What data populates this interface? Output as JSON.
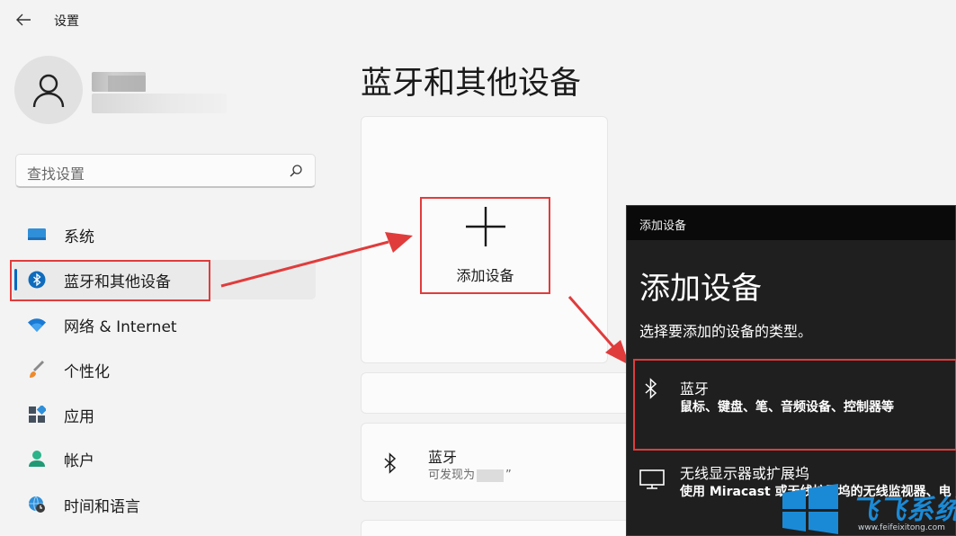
{
  "app": {
    "title": "设置"
  },
  "search": {
    "placeholder": "查找设置"
  },
  "sidebar": {
    "items": [
      {
        "label": "系统",
        "icon": "system-icon"
      },
      {
        "label": "蓝牙和其他设备",
        "icon": "bluetooth-icon",
        "active": true
      },
      {
        "label": "网络 & Internet",
        "icon": "wifi-icon"
      },
      {
        "label": "个性化",
        "icon": "brush-icon"
      },
      {
        "label": "应用",
        "icon": "apps-icon"
      },
      {
        "label": "帐户",
        "icon": "account-icon"
      },
      {
        "label": "时间和语言",
        "icon": "globe-clock-icon"
      }
    ]
  },
  "main": {
    "title": "蓝牙和其他设备",
    "add_device_label": "添加设备",
    "bluetooth_card": {
      "title": "蓝牙",
      "sub_prefix": "可发现为",
      "sub_suffix": "”"
    }
  },
  "dialog": {
    "caption": "添加设备",
    "heading": "添加设备",
    "subtitle": "选择要添加的设备的类型。",
    "options": [
      {
        "title": "蓝牙",
        "desc": "鼠标、键盘、笔、音频设备、控制器等",
        "icon": "bluetooth-icon"
      },
      {
        "title": "无线显示器或扩展坞",
        "desc": "使用 Miracast 或无线扩展坞的无线监视器、电",
        "icon": "monitor-icon"
      }
    ]
  },
  "watermark": {
    "text": "飞飞系统",
    "url": "www.feifeixitong.com"
  },
  "colors": {
    "accent": "#0067c0",
    "highlight": "#e03c3c",
    "dialog_bg": "#1f1f1f",
    "window_bg": "#f3f3f3"
  }
}
